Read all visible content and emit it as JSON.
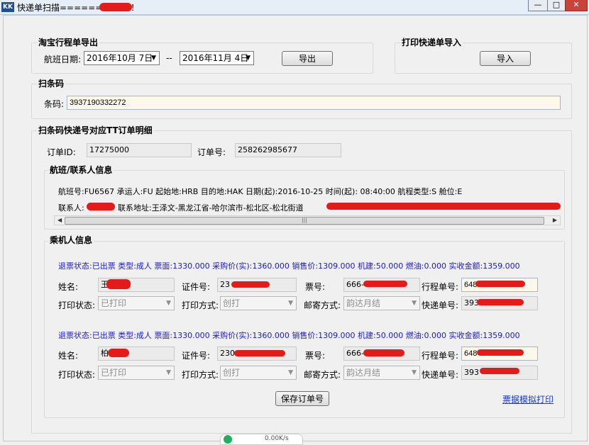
{
  "window": {
    "icon_label": "KK",
    "title": "快递单扫描======  欢迎您！",
    "min": "—",
    "max": "□",
    "close": "✕"
  },
  "export": {
    "title": "淘宝行程单导出",
    "date_label": "航班日期:",
    "date_from": "2016年10月 7日",
    "separator": "--",
    "date_to": "2016年11月 4日",
    "button": "导出"
  },
  "import": {
    "title": "打印快递单导入",
    "button": "导入"
  },
  "scan": {
    "title": "扫条码",
    "barcode_label": "条码:",
    "barcode_value": "3937190332272"
  },
  "detail": {
    "title": "扫条码快递号对应TT订单明细",
    "order_id_label": "订单ID:",
    "order_id": "17275000",
    "order_no_label": "订单号:",
    "order_no": "258262985677"
  },
  "flight": {
    "title": "航班/联系人信息",
    "line1": "航班号:FU6567 承运人:FU 起始地:HRB 目的地:HAK 日期(起):2016-10-25  时间(起): 08:40:00 航程类型:S 舱位:E",
    "contact_label": "联系人:",
    "address_text": "联系地址:王泽文-黑龙江省-哈尔滨市-松北区-松北街道"
  },
  "passengers": {
    "title": "乘机人信息",
    "items": [
      {
        "summary": "退票状态:已出票 类型:成人 票面:1330.000 采购价(实):1360.000 销售价:1309.000 机建:50.000 燃油:0.000 实收金额:1359.000",
        "name_label": "姓名:",
        "name": "王",
        "id_label": "证件号:",
        "id_value": "23 0423",
        "ticket_label": "票号:",
        "ticket_value": "666-",
        "itinerary_label": "行程单号:",
        "itinerary_value": "648",
        "print_status_label": "打印状态:",
        "print_status": "已打印",
        "print_method_label": "打印方式:",
        "print_method": "创打",
        "mail_method_label": "邮寄方式:",
        "mail_method": "韵达月结",
        "express_label": "快递单号:",
        "express_value": "393"
      },
      {
        "summary": "退票状态:已出票 类型:成人 票面:1330.000 采购价(实):1360.000 销售价:1309.000 机建:50.000 燃油:0.000 实收金额:1359.000",
        "name_label": "姓名:",
        "name": "柏",
        "id_label": "证件号:",
        "id_value": "230 X",
        "ticket_label": "票号:",
        "ticket_value": "666-",
        "itinerary_label": "行程单号:",
        "itinerary_value": "648",
        "print_status_label": "打印状态:",
        "print_status": "已打印",
        "print_method_label": "打印方式:",
        "print_method": "创打",
        "mail_method_label": "邮寄方式:",
        "mail_method": "韵达月结",
        "express_label": "快递单号:",
        "express_value": "393"
      }
    ],
    "save_button": "保存订单号",
    "print_link": "票据模拟打印"
  },
  "status": {
    "speed": "0.00K/s"
  },
  "colors": {
    "link": "#1a3cc9",
    "summary_text": "#1a1ad0",
    "redaction": "#e31b1b"
  }
}
